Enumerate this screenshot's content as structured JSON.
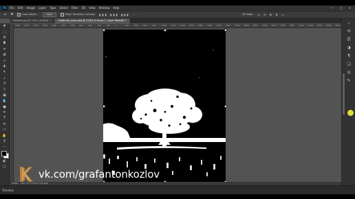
{
  "menubar": {
    "items": [
      "File",
      "Edit",
      "Image",
      "Layer",
      "Type",
      "Select",
      "Filter",
      "3D",
      "View",
      "Window",
      "Help"
    ],
    "window_controls": [
      "—",
      "□",
      "✕"
    ]
  },
  "options": {
    "auto_select_label": "Auto-Select:",
    "auto_select_value": "Layer",
    "transform_controls_label": "Show Transform Controls",
    "threed_mode_label": "3D Mode:"
  },
  "tabs": [
    {
      "label": "Rabbots.jpg @ 100% (RGB/8) *",
      "active": false
    },
    {
      "label": "Свойство_ночь.psd @ 23,8% (Curves 1, Layer Mask/8) *",
      "active": true
    }
  ],
  "ruler": {
    "ticks": [
      "2200",
      "2000",
      "1800",
      "1600",
      "1400",
      "1200",
      "1000",
      "800",
      "600",
      "400",
      "200",
      "0",
      "200",
      "400",
      "600",
      "800",
      "1000",
      "1200",
      "1400",
      "1600",
      "1800",
      "2000",
      "2200",
      "2400",
      "2600",
      "2800",
      "3000",
      "3200",
      "3400",
      "3600",
      "3800",
      "4000",
      "4200",
      "4400",
      "4600",
      "4800"
    ]
  },
  "status": {
    "zoom": "23,8%",
    "doc_info": "Doc: 3,1 x 3,8 cm (72 ppi)"
  },
  "timeline": {
    "label": "Timeline"
  },
  "watermark": {
    "text": "vk.com/grafantonkozlov"
  },
  "colors": {
    "accent": "#31a8ff",
    "cursor": "#f0f23a",
    "workspace": "#535353",
    "chrome": "#323232"
  }
}
